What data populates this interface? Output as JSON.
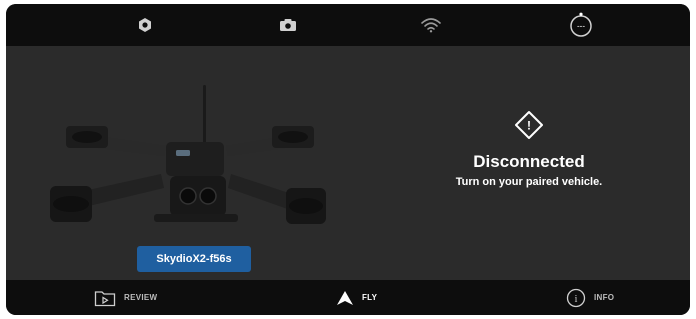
{
  "topbar": {
    "items": [
      {
        "icon": "settings-icon"
      },
      {
        "icon": "camera-icon"
      },
      {
        "icon": "wifi-icon"
      },
      {
        "icon": "battery-timer-icon",
        "readout": "---"
      }
    ]
  },
  "vehicle": {
    "name": "SkydioX2-f56s"
  },
  "status": {
    "icon": "warning-diamond-icon",
    "glyph": "!",
    "title": "Disconnected",
    "subtitle": "Turn on your paired vehicle."
  },
  "bottom_nav": {
    "review_label": "REVIEW",
    "fly_label": "FLY",
    "info_label": "INFO",
    "info_glyph": "i",
    "active": "FLY"
  },
  "colors": {
    "background": "#2b2b2b",
    "bars": "#0d0d0d",
    "vehicle_badge": "#1f5fa0",
    "text": "#ffffff"
  }
}
